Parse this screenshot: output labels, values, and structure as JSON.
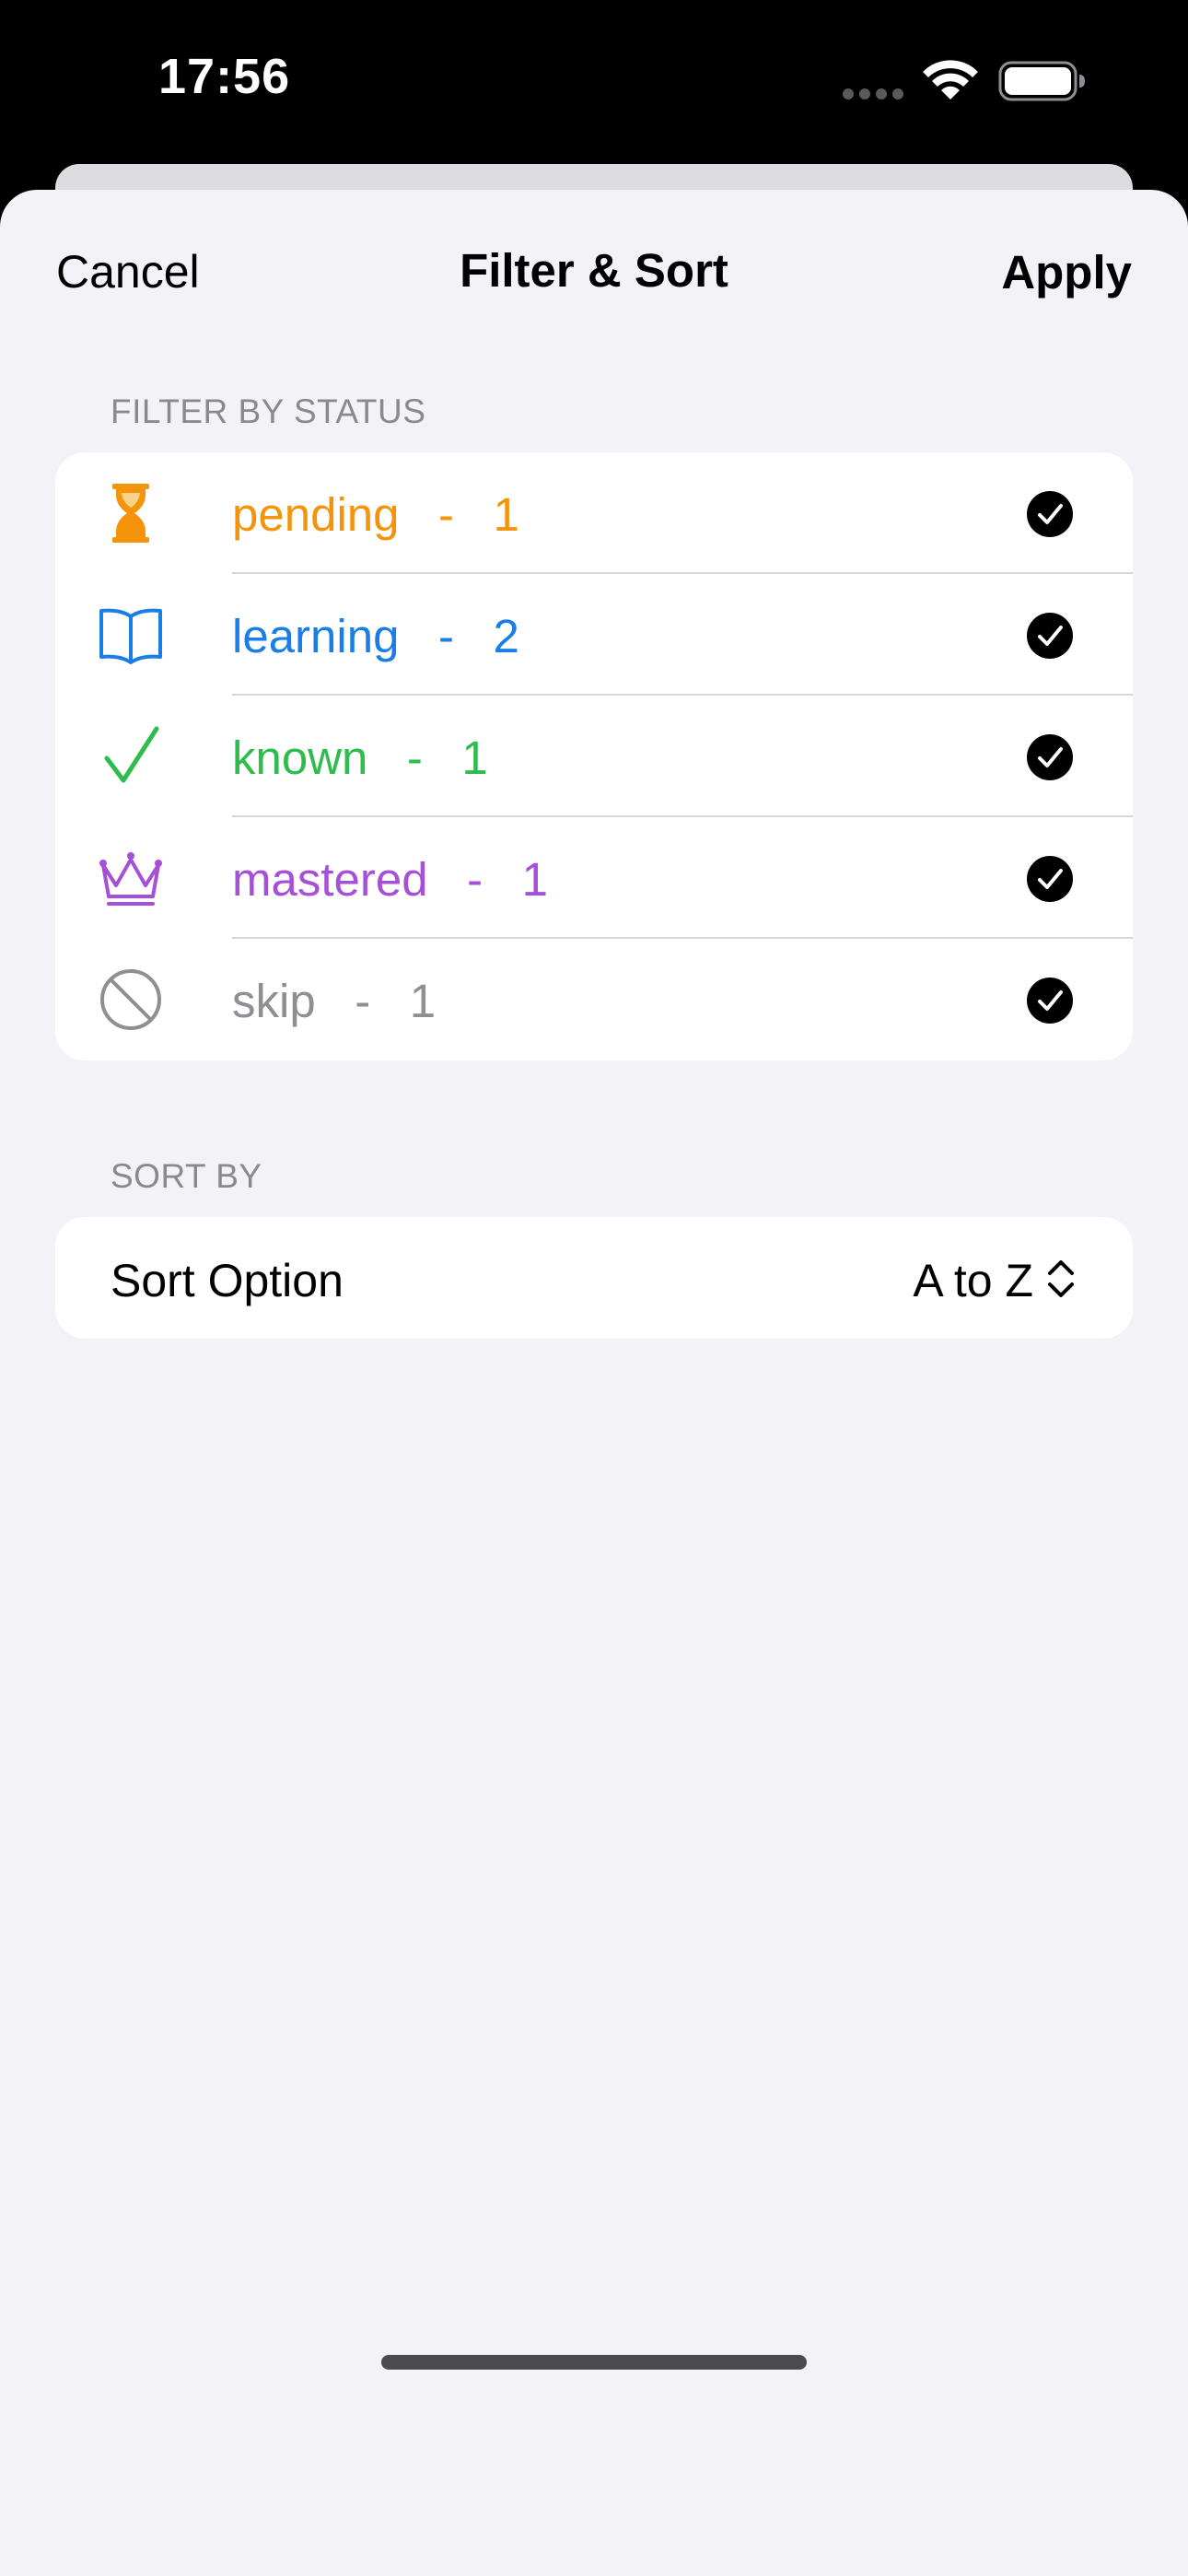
{
  "status_bar": {
    "time": "17:56"
  },
  "nav": {
    "cancel_label": "Cancel",
    "title": "Filter & Sort",
    "apply_label": "Apply"
  },
  "filter_section": {
    "header": "FILTER BY STATUS",
    "items": [
      {
        "name": "pending",
        "separator": "-",
        "count": "1",
        "label": "pending   -   1",
        "color": "#f5930a",
        "icon": "hourglass-icon",
        "checked": true
      },
      {
        "name": "learning",
        "separator": "-",
        "count": "2",
        "label": "learning   -   2",
        "color": "#1a7ee6",
        "icon": "book-icon",
        "checked": true
      },
      {
        "name": "known",
        "separator": "-",
        "count": "1",
        "label": "known   -   1",
        "color": "#2ebd4c",
        "icon": "checkmark-icon",
        "checked": true
      },
      {
        "name": "mastered",
        "separator": "-",
        "count": "1",
        "label": "mastered   -   1",
        "color": "#a64fd8",
        "icon": "crown-icon",
        "checked": true
      },
      {
        "name": "skip",
        "separator": "-",
        "count": "1",
        "label": "skip   -   1",
        "color": "#8e8e93",
        "icon": "prohibit-icon",
        "checked": true
      }
    ]
  },
  "sort_section": {
    "header": "SORT BY",
    "option_label": "Sort Option",
    "option_value": "A to Z"
  },
  "colors": {
    "sheet_background": "#f2f2f7",
    "card_background": "#ffffff",
    "secondary_text": "#8a8a8e"
  }
}
